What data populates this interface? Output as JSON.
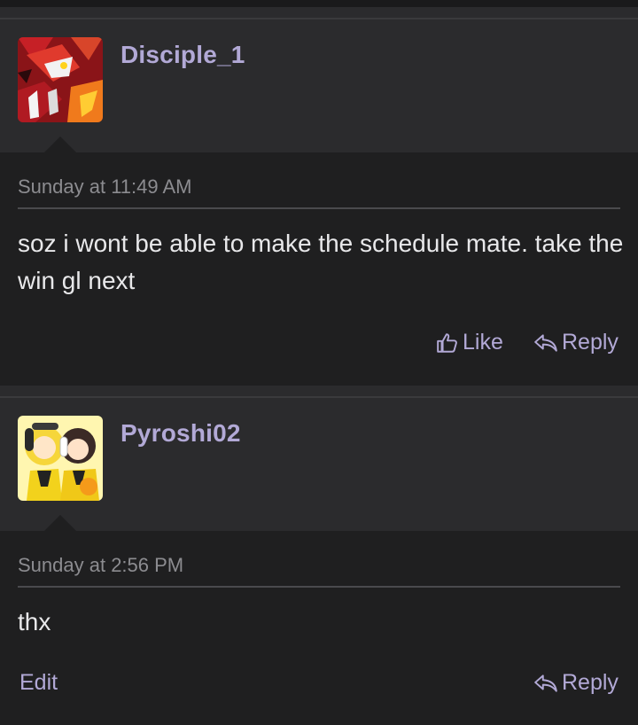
{
  "posts": [
    {
      "username": "Disciple_1",
      "timestamp": "Sunday at 11:49 AM",
      "message": "soz i wont be able to make the schedule mate. take the win gl next",
      "actions": {
        "like_label": "Like",
        "reply_label": "Reply"
      },
      "avatar_icon": "red-monster-avatar"
    },
    {
      "username": "Pyroshi02",
      "timestamp": "Sunday at 2:56 PM",
      "message": "thx",
      "actions": {
        "edit_label": "Edit",
        "reply_label": "Reply"
      },
      "avatar_icon": "yellow-anime-avatar"
    }
  ],
  "colors": {
    "username": "#b2a9d6",
    "accent": "#b2a9d6",
    "text": "#e8e8ea",
    "muted": "#8c8c90"
  }
}
